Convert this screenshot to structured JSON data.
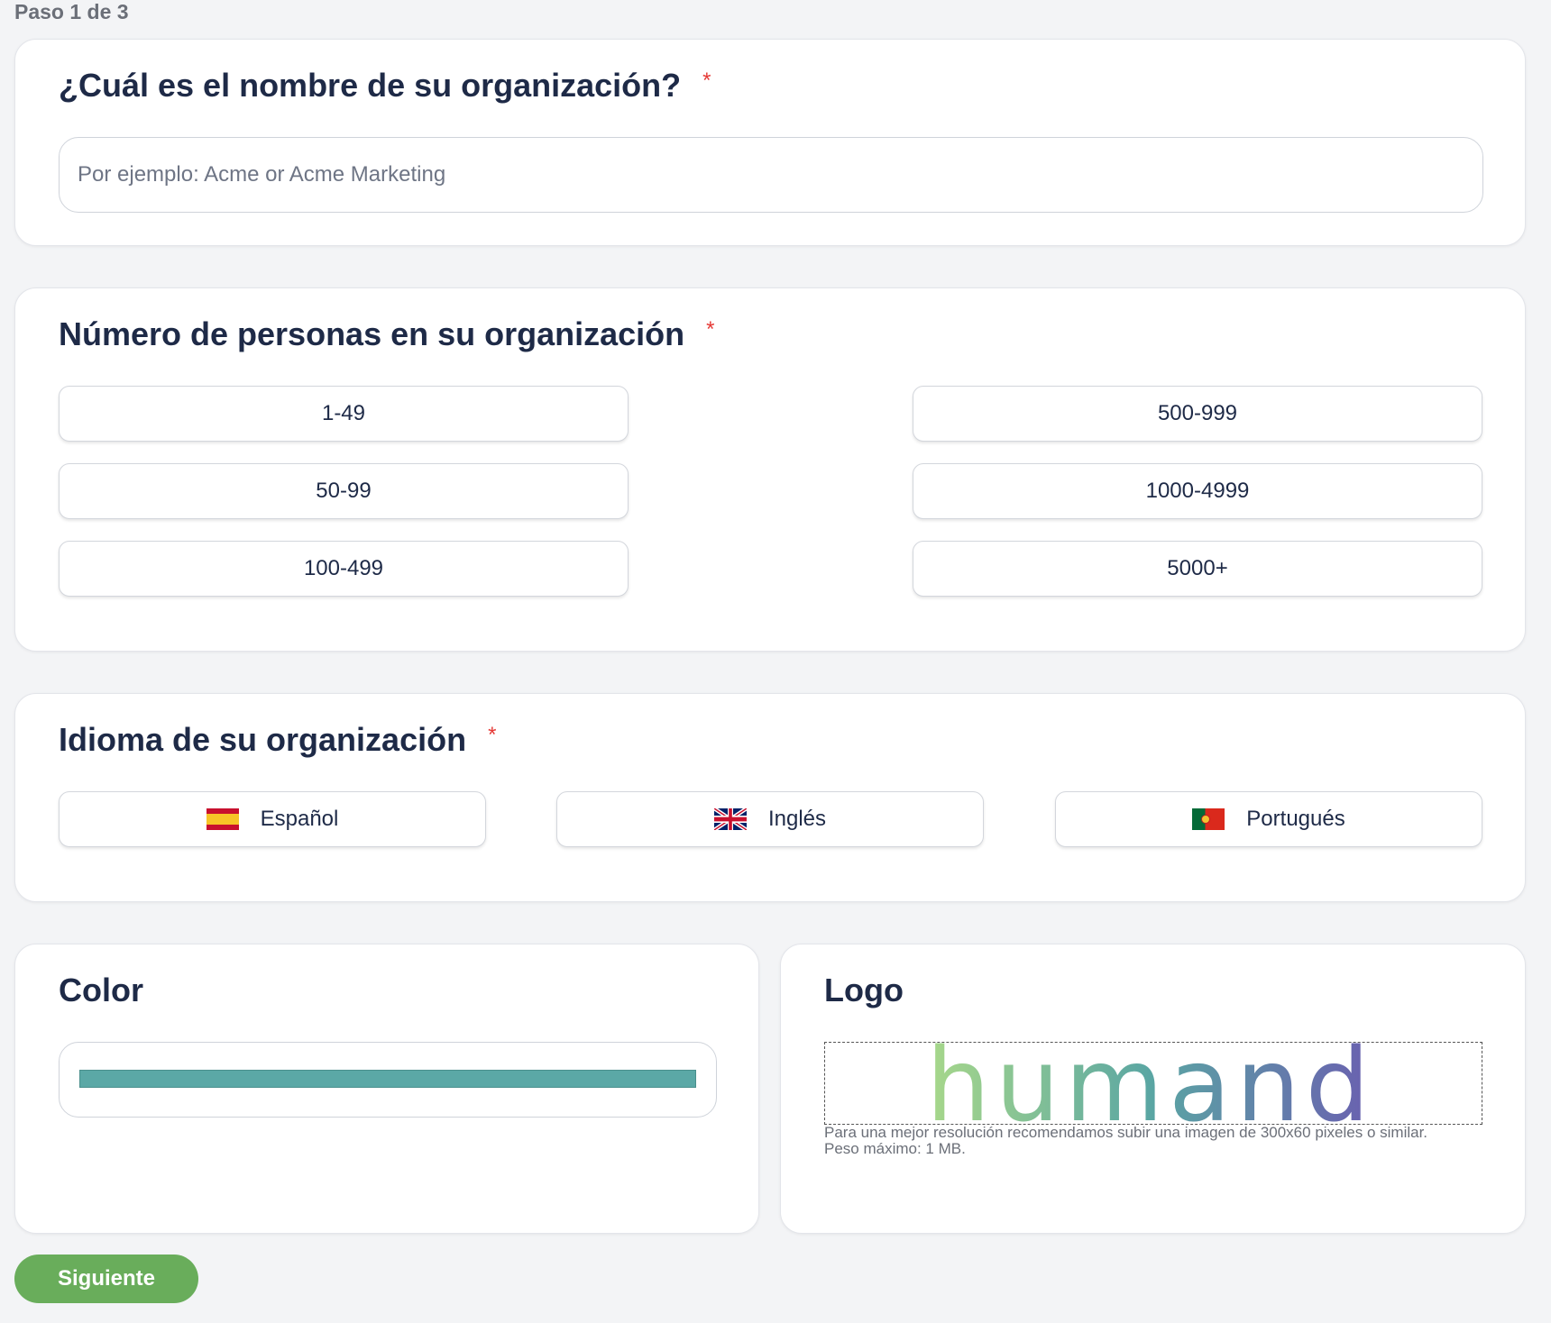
{
  "step_label": "Paso 1 de 3",
  "org_name": {
    "title": "¿Cuál es el nombre de su organización?",
    "required_mark": "*",
    "placeholder": "Por ejemplo: Acme or Acme Marketing",
    "value": ""
  },
  "org_size": {
    "title": "Número de personas en su organización",
    "required_mark": "*",
    "options": [
      "1-49",
      "50-99",
      "100-499",
      "500-999",
      "1000-4999",
      "5000+"
    ]
  },
  "language": {
    "title": "Idioma de su organización",
    "required_mark": "*",
    "options": [
      {
        "label": "Español",
        "icon": "spain-flag-icon"
      },
      {
        "label": "Inglés",
        "icon": "uk-flag-icon"
      },
      {
        "label": "Portugués",
        "icon": "portugal-flag-icon"
      }
    ]
  },
  "color": {
    "title": "Color",
    "value": "#5ba8a6"
  },
  "logo": {
    "title": "Logo",
    "logo_text": "humand",
    "gradient_colors": [
      "#a8d88a",
      "#5aa6a3",
      "#6a5fb0"
    ],
    "hint": "Para una mejor resolución recomendamos subir una imagen de 300x60 pixeles o similar. Peso máximo: 1 MB."
  },
  "next_button": "Siguiente"
}
